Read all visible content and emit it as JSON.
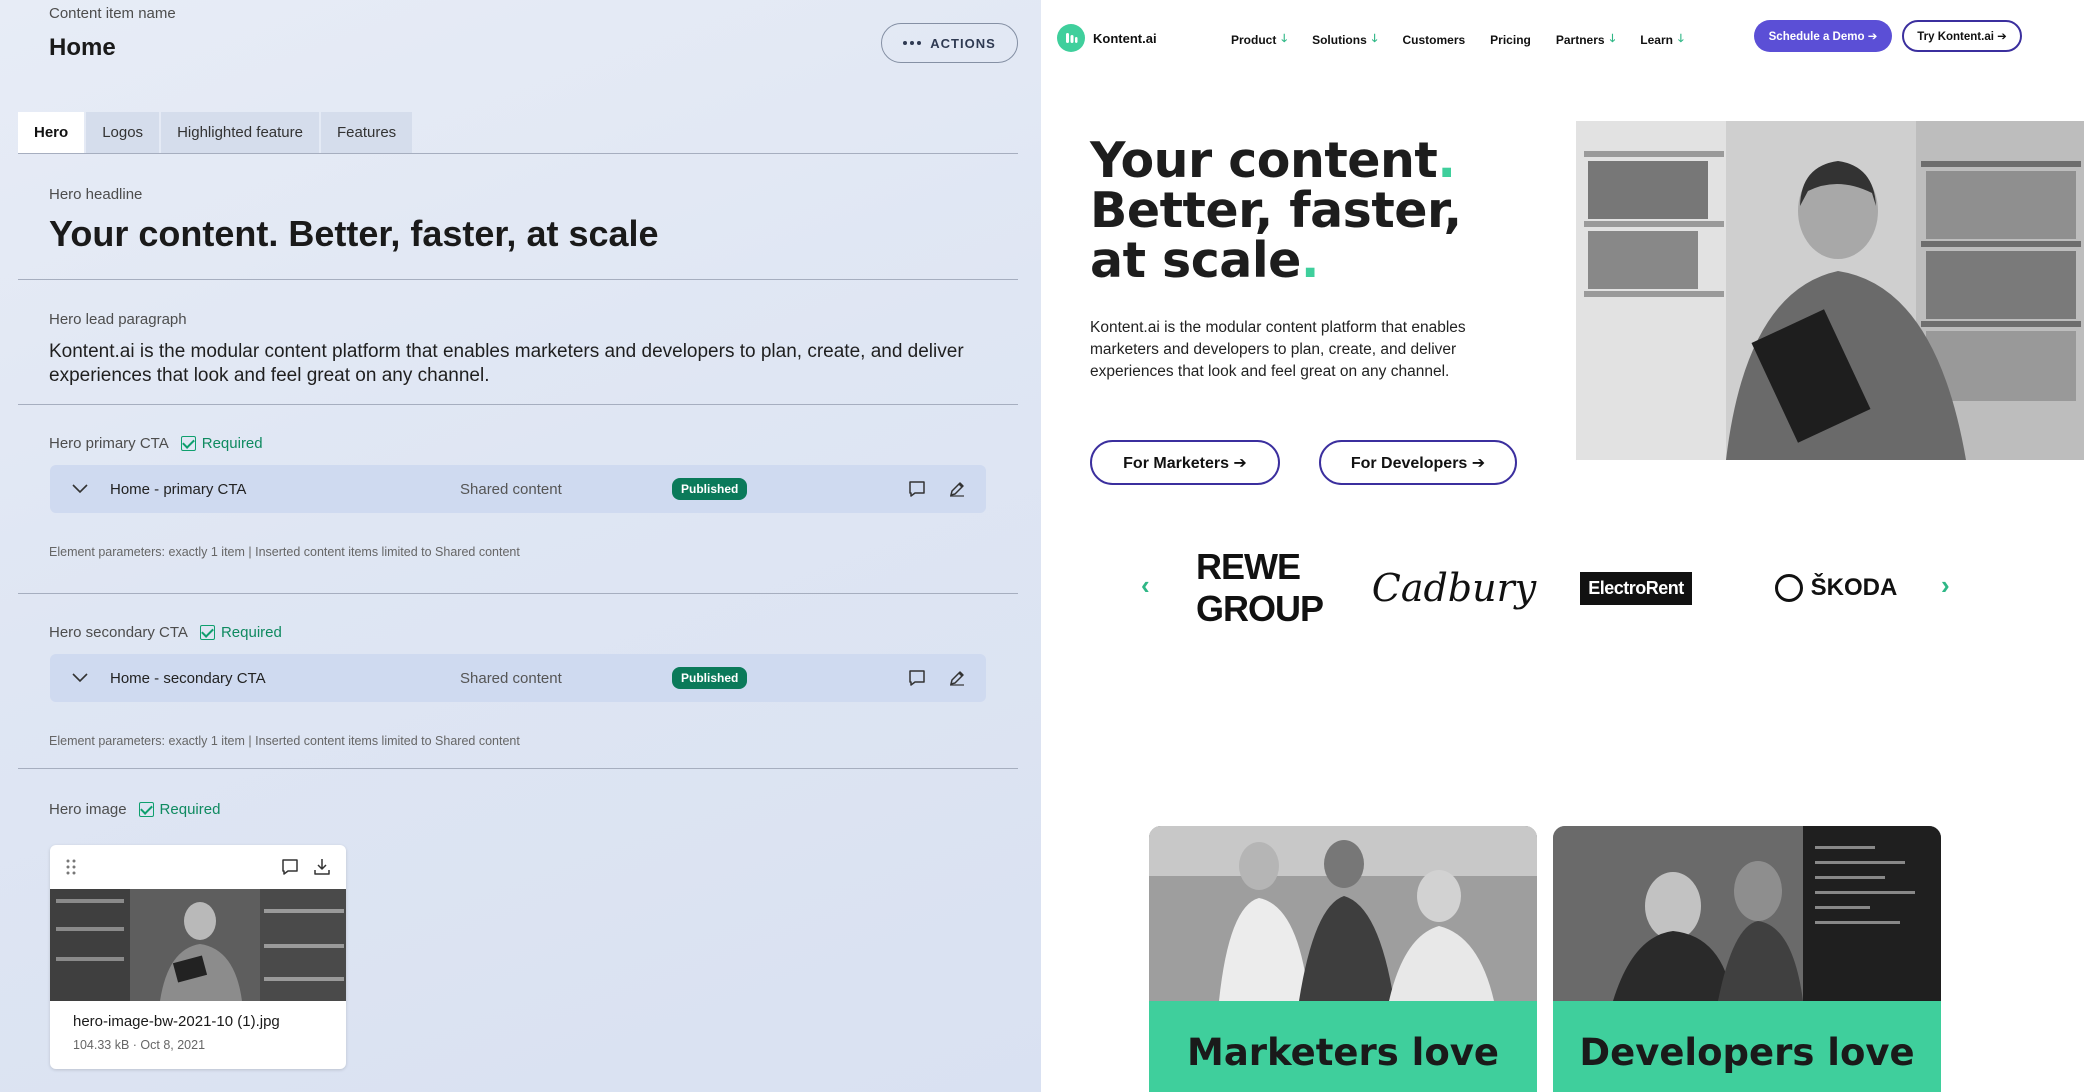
{
  "editor": {
    "item_name_label": "Content item name",
    "item_name": "Home",
    "actions_label": "ACTIONS",
    "tabs": [
      {
        "label": "Hero",
        "active": true
      },
      {
        "label": "Logos",
        "active": false
      },
      {
        "label": "Highlighted feature",
        "active": false
      },
      {
        "label": "Features",
        "active": false
      }
    ],
    "hero_headline_label": "Hero headline",
    "hero_headline": "Your content. Better, faster, at scale",
    "hero_lead_label": "Hero lead paragraph",
    "hero_lead": "Kontent.ai is the modular content platform that enables marketers and developers to plan, create, and deliver experiences that look and feel great on any channel.",
    "required_label": "Required",
    "primary_cta": {
      "label": "Hero primary CTA",
      "item_name": "Home - primary CTA",
      "content_type": "Shared content",
      "status": "Published",
      "params": "Element parameters: exactly 1 item | Inserted content items limited to Shared content"
    },
    "secondary_cta": {
      "label": "Hero secondary CTA",
      "item_name": "Home - secondary CTA",
      "content_type": "Shared content",
      "status": "Published",
      "params": "Element parameters: exactly 1 item | Inserted content items limited to Shared content"
    },
    "hero_image": {
      "label": "Hero image",
      "file_name": "hero-image-bw-2021-10 (1).jpg",
      "file_meta": "104.33 kB · Oct 8, 2021"
    }
  },
  "site": {
    "logo_text": "Kontent.ai",
    "nav": [
      {
        "label": "Product",
        "dropdown": true
      },
      {
        "label": "Solutions",
        "dropdown": true
      },
      {
        "label": "Customers",
        "dropdown": false
      },
      {
        "label": "Pricing",
        "dropdown": false
      },
      {
        "label": "Partners",
        "dropdown": true
      },
      {
        "label": "Learn",
        "dropdown": true
      }
    ],
    "schedule_demo": "Schedule a Demo ➔",
    "try_label": "Try Kontent.ai ➔",
    "hero_line1": "Your content",
    "hero_line2": "Better, faster,",
    "hero_line3": "at scale",
    "hero_dot": ".",
    "hero_paragraph": "Kontent.ai is the modular content platform that enables marketers and developers to plan, create, and deliver experiences that look and feel great on any channel.",
    "cta_marketers": "For Marketers ➔",
    "cta_developers": "For Developers ➔",
    "brands": [
      "REWE GROUP",
      "Cadbury",
      "ElectroRent",
      "ŠKODA"
    ],
    "card_marketers": "Marketers love",
    "card_developers": "Developers love",
    "accent_green": "#3fcf9c",
    "accent_purple": "#5b4fd6"
  }
}
